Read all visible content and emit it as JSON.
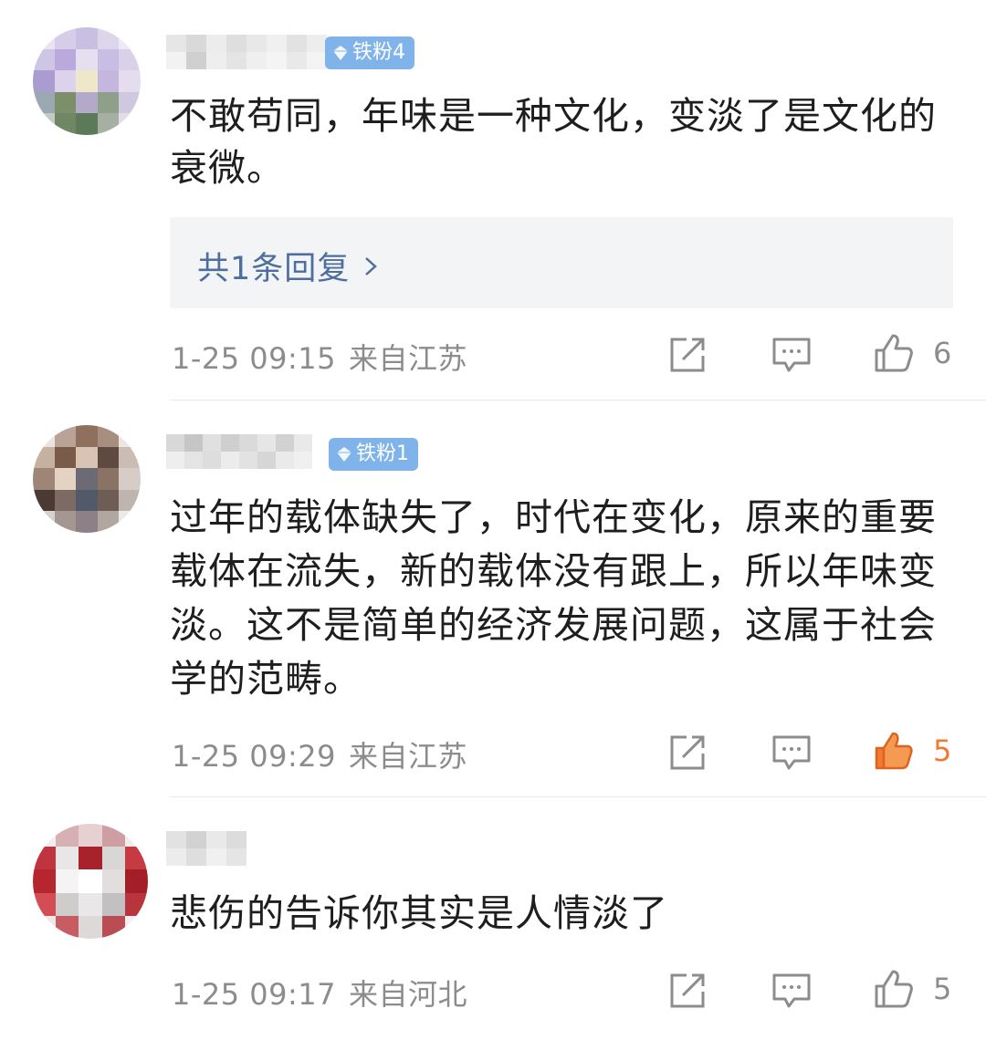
{
  "comments": [
    {
      "badge": "铁粉4",
      "text": "不敢苟同，年味是一种文化，变淡了是文化的衰微。",
      "reply_label": "共1条回复",
      "time": "1-25 09:15",
      "location": "来自江苏",
      "likes": "6",
      "liked": false
    },
    {
      "badge": "铁粉1",
      "text": "过年的载体缺失了，时代在变化，原来的重要载体在流失，新的载体没有跟上，所以年味变淡。这不是简单的经济发展问题，这属于社会学的范畴。",
      "time": "1-25 09:29",
      "location": "来自江苏",
      "likes": "5",
      "liked": true
    },
    {
      "text": "悲伤的告诉你其实是人情淡了",
      "time": "1-25 09:17",
      "location": "来自河北",
      "likes": "5",
      "liked": false
    }
  ],
  "icons": {
    "share": "share-icon",
    "comment": "comment-icon",
    "like": "thumbs-up-icon",
    "badge": "diamond-icon"
  },
  "colors": {
    "badge_bg": "#7fb3ea",
    "reply_link": "#4e6e9e",
    "liked": "#f07a32",
    "meta": "#8c8c8c"
  }
}
